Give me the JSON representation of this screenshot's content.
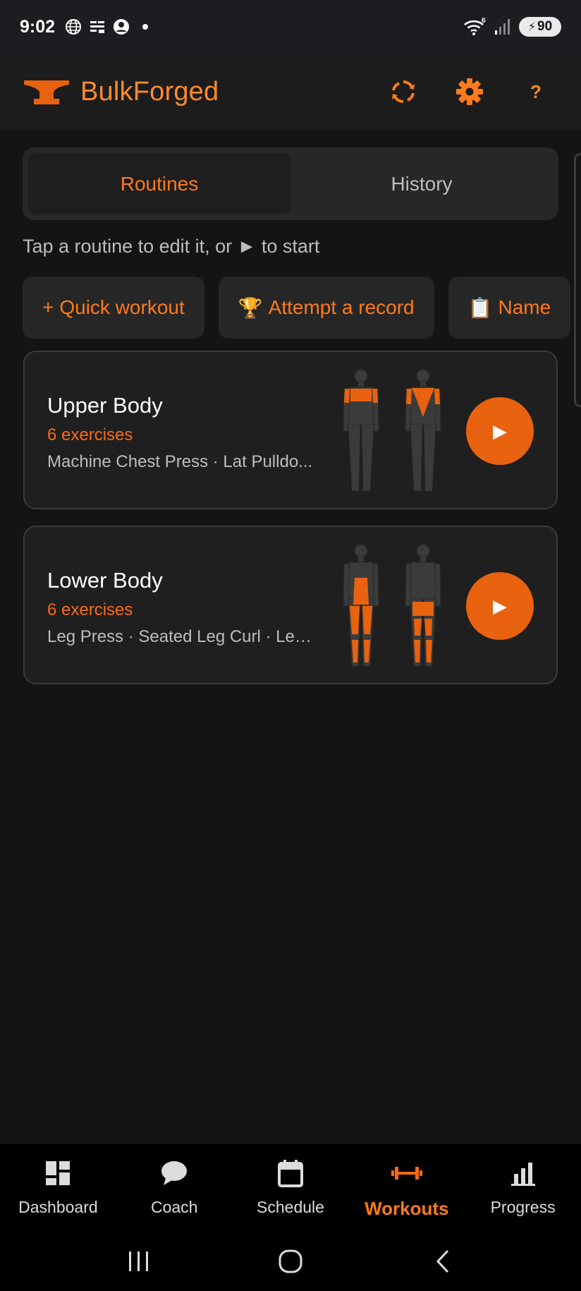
{
  "status_bar": {
    "time": "9:02",
    "battery": "90",
    "wifi_badge": "6"
  },
  "app": {
    "name": "BulkForged",
    "accent": "#ff8a2b"
  },
  "actions": {
    "sync_icon": "sync-icon",
    "settings_icon": "gear-icon",
    "help": "?"
  },
  "tabs": [
    {
      "label": "Routines",
      "active": true
    },
    {
      "label": "History",
      "active": false
    }
  ],
  "hint": "Tap a routine to edit it, or ► to start",
  "chips": [
    {
      "icon": "+",
      "label": "Quick workout"
    },
    {
      "icon": "🏆",
      "label": "Attempt a record"
    },
    {
      "icon": "📋",
      "label": "Name"
    }
  ],
  "routines": [
    {
      "title": "Upper Body",
      "count": "6 exercises",
      "exercises": "Machine Chest Press · Lat Pulldo...",
      "play": "▶"
    },
    {
      "title": "Lower Body",
      "count": "6 exercises",
      "exercises": "Leg Press · Seated Leg Curl · Leg ...",
      "play": "▶"
    }
  ],
  "nav": [
    {
      "label": "Dashboard",
      "icon": "dashboard-icon"
    },
    {
      "label": "Coach",
      "icon": "chat-bubble-icon"
    },
    {
      "label": "Schedule",
      "icon": "calendar-icon"
    },
    {
      "label": "Workouts",
      "icon": "dumbbell-icon",
      "active": true
    },
    {
      "label": "Progress",
      "icon": "bar-chart-icon"
    }
  ]
}
